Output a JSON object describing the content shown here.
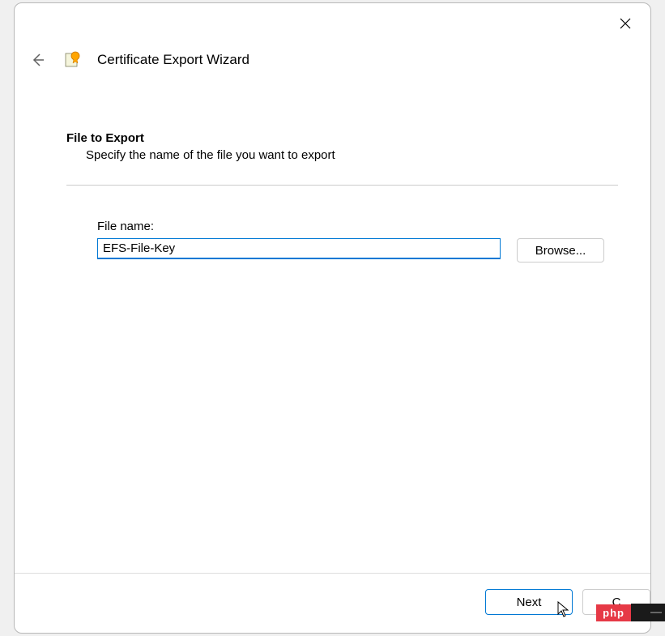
{
  "window": {
    "title": "Certificate Export Wizard"
  },
  "content": {
    "heading": "File to Export",
    "description": "Specify the name of the file you want to export",
    "file_name_label": "File name:",
    "file_name_value": "EFS-File-Key",
    "browse_label": "Browse..."
  },
  "footer": {
    "next_label": "Next",
    "cancel_label": "C"
  },
  "badge": {
    "text": "php"
  }
}
